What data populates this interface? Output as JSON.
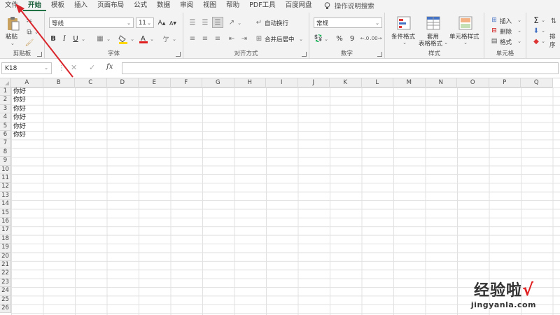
{
  "tabs": [
    "文件",
    "开始",
    "模板",
    "插入",
    "页面布局",
    "公式",
    "数据",
    "审阅",
    "视图",
    "帮助",
    "PDF工具",
    "百度网盘"
  ],
  "active_tab": "开始",
  "help_search": "操作说明搜索",
  "ribbon": {
    "clipboard": {
      "label": "剪贴板",
      "paste": "粘贴"
    },
    "font": {
      "label": "字体",
      "font_name": "等线",
      "font_size": "11",
      "bold": "B",
      "italic": "I",
      "underline": "U"
    },
    "alignment": {
      "label": "对齐方式",
      "wrap_text": "自动换行",
      "merge_center": "合并后居中"
    },
    "number": {
      "label": "数字",
      "format": "常规",
      "percent": "%",
      "comma": "9"
    },
    "styles": {
      "label": "样式",
      "conditional": "条件格式",
      "table_format_1": "套用",
      "table_format_2": "表格格式",
      "cell_styles": "单元格样式"
    },
    "cells": {
      "label": "单元格",
      "insert": "插入",
      "delete": "删除",
      "format": "格式"
    },
    "editing": {
      "sort": "排序"
    }
  },
  "formula_bar": {
    "name_box": "K18",
    "fx": "fx",
    "value": ""
  },
  "columns": [
    "A",
    "B",
    "C",
    "D",
    "E",
    "F",
    "G",
    "H",
    "I",
    "J",
    "K",
    "L",
    "M",
    "N",
    "O",
    "P",
    "Q"
  ],
  "rows": [
    "1",
    "2",
    "3",
    "4",
    "5",
    "6",
    "7",
    "8",
    "9",
    "10",
    "11",
    "12",
    "13",
    "14",
    "15",
    "16",
    "17",
    "18",
    "19",
    "20",
    "21",
    "22",
    "23",
    "24",
    "25",
    "26"
  ],
  "cells": [
    {
      "ref": "A1",
      "value": "你好"
    },
    {
      "ref": "A2",
      "value": "你好"
    },
    {
      "ref": "A3",
      "value": "你好"
    },
    {
      "ref": "A4",
      "value": "你好"
    },
    {
      "ref": "A5",
      "value": "你好"
    },
    {
      "ref": "A6",
      "value": "你好"
    }
  ],
  "watermark": {
    "main": "经验啦",
    "url": "jingyanla.com"
  },
  "colors": {
    "accent": "#217346",
    "arrow": "#d9262c",
    "grid": "#e1e1e1",
    "watermark_check": "#e02020"
  }
}
